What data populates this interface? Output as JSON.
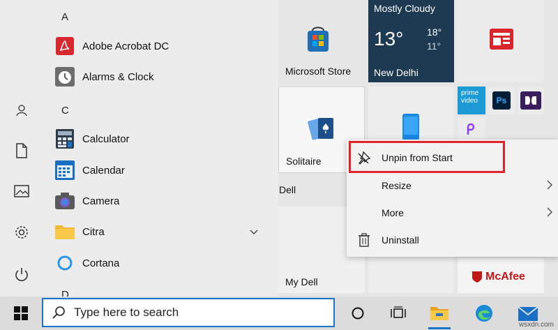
{
  "app_list": {
    "letters": {
      "a": "A",
      "c": "C",
      "d": "D"
    },
    "apps": [
      {
        "label": "Adobe Acrobat DC",
        "icon": "acrobat-icon"
      },
      {
        "label": "Alarms & Clock",
        "icon": "alarm-clock-icon"
      },
      {
        "label": "Calculator",
        "icon": "calculator-icon"
      },
      {
        "label": "Calendar",
        "icon": "calendar-icon"
      },
      {
        "label": "Camera",
        "icon": "camera-icon"
      },
      {
        "label": "Citra",
        "icon": "folder-icon"
      },
      {
        "label": "Cortana",
        "icon": "cortana-icon"
      }
    ]
  },
  "tiles": {
    "store": {
      "label": "Microsoft Store"
    },
    "weather": {
      "condition": "Mostly Cloudy",
      "temp": "13°",
      "high": "18°",
      "low": "11°",
      "city": "New Delhi"
    },
    "solitaire": {
      "label": "Solitaire"
    },
    "group_dell": "Dell",
    "mydell": {
      "label": "My Dell"
    },
    "prime": {
      "text1": "prime",
      "text2": "video"
    },
    "ps": {
      "text": "Ps"
    },
    "mcafee": {
      "text": "McAfee"
    }
  },
  "context_menu": {
    "items": [
      {
        "label": "Unpin from Start",
        "icon": "unpin-icon"
      },
      {
        "label": "Resize"
      },
      {
        "label": "More"
      },
      {
        "label": "Uninstall",
        "icon": "trash-icon"
      }
    ]
  },
  "taskbar": {
    "search_placeholder": "Type here to search"
  },
  "watermark": "wsxdn.com",
  "colors": {
    "highlight": "#e0242a",
    "search_border": "#1a73c8",
    "weather_tile": "#1d3a52",
    "acrobat": "#d7282f"
  }
}
